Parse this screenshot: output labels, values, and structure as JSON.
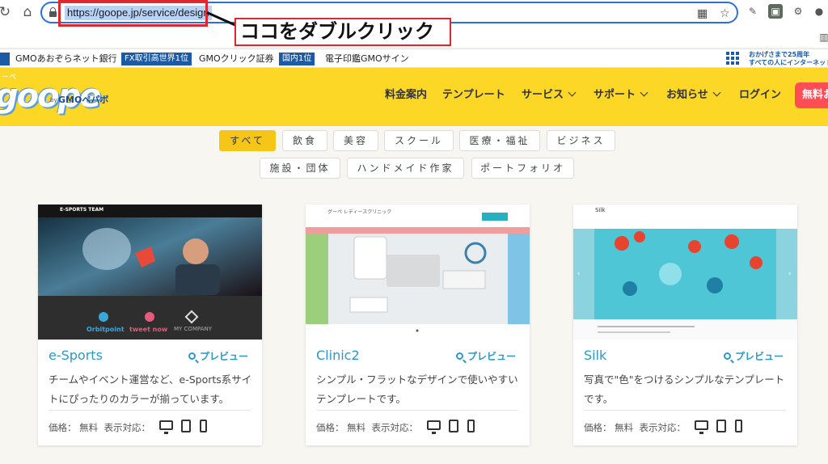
{
  "browser": {
    "url": "https://goope.jp/service/design",
    "callout": "ココをダブルクリック"
  },
  "adstrip": {
    "items": [
      {
        "type": "text",
        "label": "GMOあおぞらネット銀行"
      },
      {
        "type": "badge",
        "label": "FX取引高世界1位"
      },
      {
        "type": "text",
        "label": "GMOクリック証券"
      },
      {
        "type": "badge",
        "label": "国内1位"
      },
      {
        "type": "text",
        "label": "電子印鑑GMOサイン"
      }
    ],
    "anniversary_line1": "おかげさまで25周年",
    "anniversary_line2": "すべての人にインターネット"
  },
  "header": {
    "logo_top": "ーぺ",
    "logo": "goope",
    "logo_by": "by",
    "logo_brand": "GMOペパボ",
    "nav": [
      {
        "label": "料金案内"
      },
      {
        "label": "テンプレート"
      },
      {
        "label": "サービス"
      },
      {
        "label": "サポート"
      },
      {
        "label": "お知らせ"
      },
      {
        "label": "ログイン"
      }
    ],
    "cta": "無料お"
  },
  "filters": {
    "row1": [
      "すべて",
      "飲食",
      "美容",
      "スクール",
      "医療・福祉",
      "ビジネス"
    ],
    "row2": [
      "施設・団体",
      "ハンドメイド作家",
      "ポートフォリオ"
    ],
    "active": "すべて"
  },
  "cards": [
    {
      "title": "e-Sports",
      "preview": "プレビュー",
      "desc": "チームやイベント運営など、e-Sports系サイトにぴったりのカラーが揃っています。",
      "price_label": "価格：",
      "price": "無料",
      "devices_label": "表示対応：",
      "thumb_header": "E-SPORTS TEAM",
      "thumb_logos": [
        "Orbitpoint",
        "tweet now",
        "MY COMPANY"
      ]
    },
    {
      "title": "Clinic2",
      "preview": "プレビュー",
      "desc": "シンプル・フラットなデザインで使いやすいテンプレートです。",
      "price_label": "価格：",
      "price": "無料",
      "devices_label": "表示対応：",
      "thumb_header": "グーペ レディースクリニック"
    },
    {
      "title": "Silk",
      "preview": "プレビュー",
      "desc": "写真で\"色\"をつけるシンプルなテンプレートです。",
      "price_label": "価格：",
      "price": "無料",
      "devices_label": "表示対応：",
      "thumb_header": "Silk"
    }
  ],
  "colors": {
    "accent_yellow": "#fcd726",
    "link_blue": "#2a9ac9",
    "highlight_red": "#e0272f",
    "cta_red": "#ff4d55"
  }
}
